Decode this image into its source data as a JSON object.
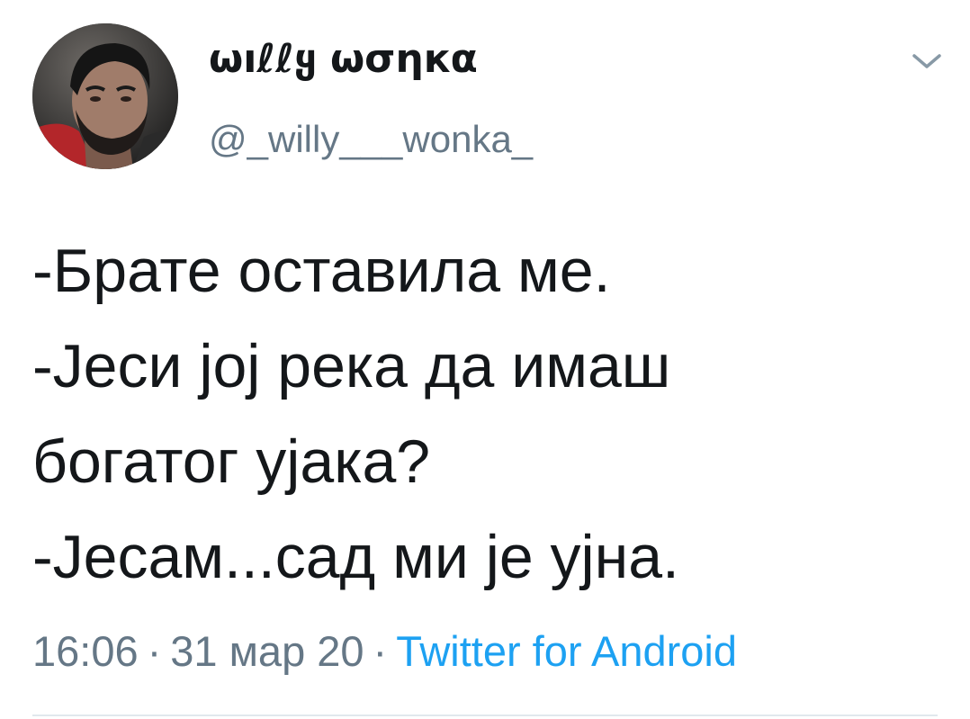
{
  "tweet": {
    "display_name": "ωıℓℓყ ωσηкα",
    "handle": "@_willy___wonka_",
    "body_lines": [
      "-Брате оставила ме.",
      "-Јеси јој река да имаш",
      "богатог ујака?",
      "-Јесам...сад ми је ујна."
    ],
    "time": "16:06",
    "date": "31 мар 20",
    "separator": "·",
    "source": "Twitter for Android"
  },
  "icons": {
    "avatar": "profile-photo",
    "menu": "chevron-down-icon"
  },
  "colors": {
    "text": "#14171a",
    "secondary": "#657786",
    "link": "#1da1f2",
    "divider": "#e1e8ed"
  }
}
